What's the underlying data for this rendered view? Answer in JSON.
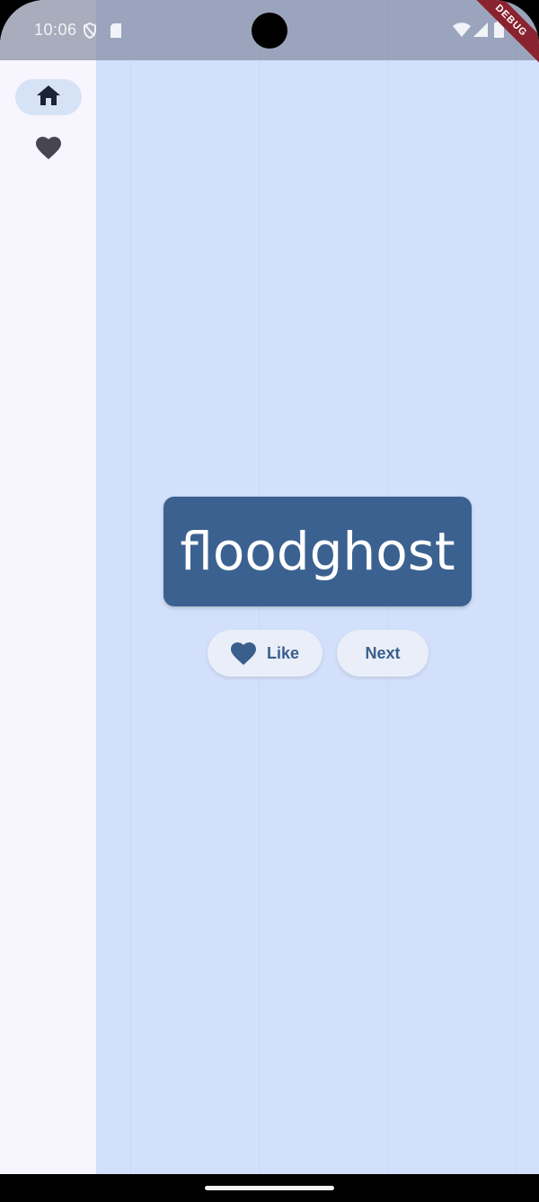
{
  "status_bar": {
    "time": "10:06",
    "left_icons": [
      "shield-icon",
      "sd-card-icon"
    ],
    "right_icons": [
      "wifi-icon",
      "cellular-signal-icon",
      "battery-icon"
    ]
  },
  "debug_banner": "DEBUG",
  "navigation_rail": {
    "items": [
      {
        "icon": "home-icon",
        "selected": true
      },
      {
        "icon": "heart-icon",
        "selected": false
      }
    ]
  },
  "main": {
    "word": "floodghost",
    "like_button_label": "Like",
    "next_button_label": "Next"
  },
  "colors": {
    "page_background": "#d2e0fb",
    "rail_background": "#f7f5fd",
    "card_background": "#3b6190",
    "card_text": "#ffffff",
    "button_background": "#e9eef8",
    "button_text": "#3b5f8c",
    "debug_banner": "#8a2330"
  }
}
